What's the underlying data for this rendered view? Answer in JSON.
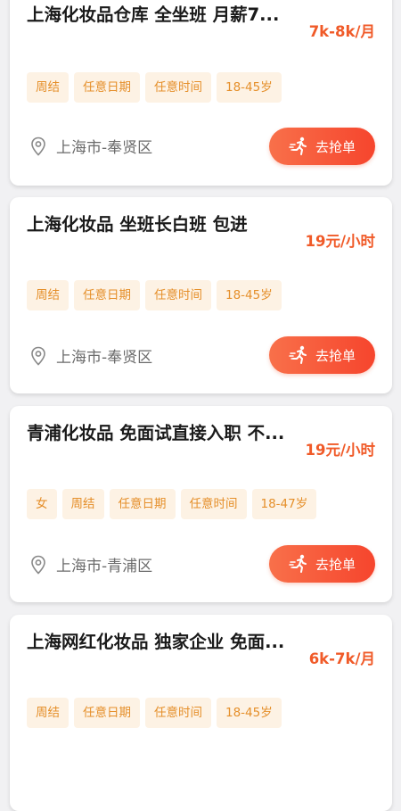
{
  "jobs": [
    {
      "title": "上海化妆品仓库 全坐班 月薪7...",
      "salary": "7k-8k/月",
      "tags": [
        "周结",
        "任意日期",
        "任意时间",
        "18-45岁"
      ],
      "location": "上海市-奉贤区",
      "button": "去抢单"
    },
    {
      "title": "上海化妆品 坐班长白班 包进",
      "salary": "19元/小时",
      "tags": [
        "周结",
        "任意日期",
        "任意时间",
        "18-45岁"
      ],
      "location": "上海市-奉贤区",
      "button": "去抢单"
    },
    {
      "title": "青浦化妆品 免面试直接入职 不...",
      "salary": "19元/小时",
      "tags": [
        "女",
        "周结",
        "任意日期",
        "任意时间",
        "18-47岁"
      ],
      "location": "上海市-青浦区",
      "button": "去抢单"
    },
    {
      "title": "上海网红化妆品 独家企业 免面...",
      "salary": "6k-7k/月",
      "tags": [
        "周结",
        "任意日期",
        "任意时间",
        "18-45岁"
      ]
    }
  ],
  "colors": {
    "accent": "#f05a28",
    "tag_bg": "#fdf2e4",
    "tag_text": "#e58f2a",
    "page_bg": "#f1f1f3"
  },
  "icons": {
    "location": "location-pin-icon",
    "grab": "running-person-icon"
  }
}
